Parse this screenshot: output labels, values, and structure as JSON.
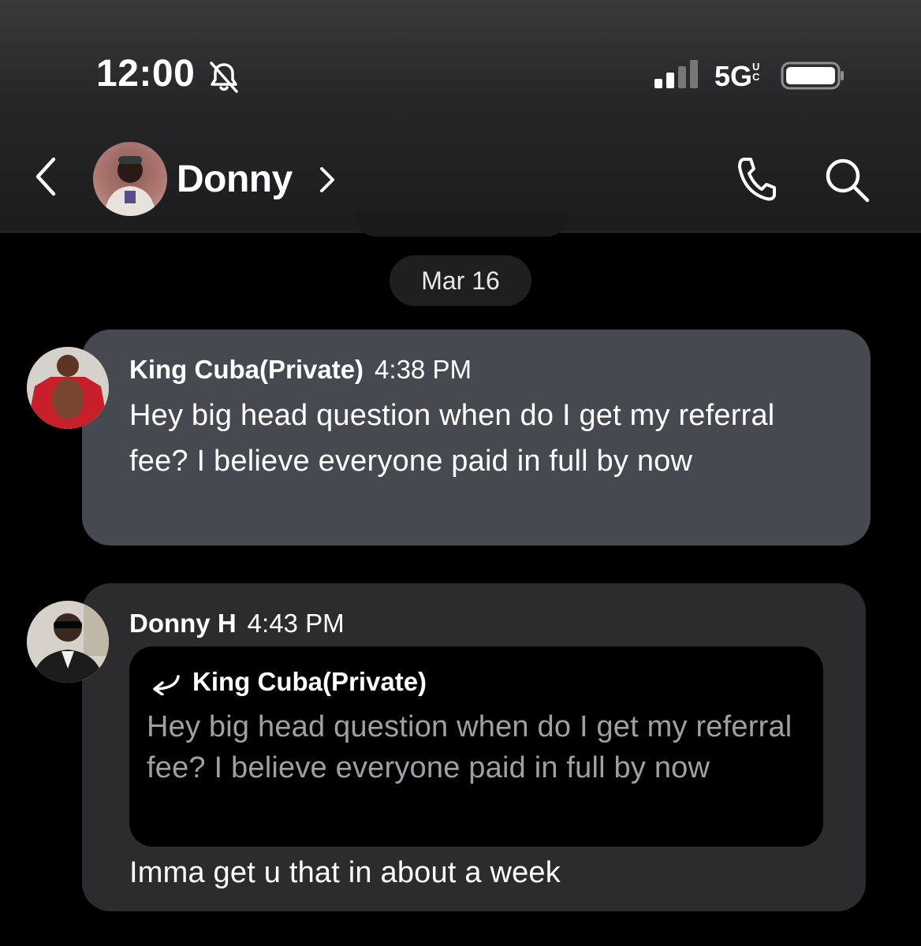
{
  "status_bar": {
    "time": "12:00",
    "network": "5G",
    "network_suffix": "UC",
    "icons": [
      "bell-muted-icon",
      "signal-icon",
      "battery-icon"
    ]
  },
  "header": {
    "contact_name": "Donny",
    "icons": [
      "back-arrow-icon",
      "chevron-right-icon",
      "phone-icon",
      "search-icon"
    ]
  },
  "conversation": {
    "date_divider": "Mar 16",
    "messages": [
      {
        "sender": "King Cuba(Private)",
        "time": "4:38 PM",
        "text": "Hey big head question when do I get my referral fee? I believe everyone paid in full by now"
      },
      {
        "sender": "Donny H",
        "time": "4:43 PM",
        "reply_to": {
          "sender": "King Cuba(Private)",
          "text": "Hey big head question when do I get my referral fee? I believe everyone paid in full by now"
        },
        "text": "Imma get u that in about a week"
      }
    ]
  },
  "colors": {
    "background": "#000000",
    "incoming_bubble": "#464950",
    "outgoing_bubble": "#2c2c2e",
    "quote_bg": "#000000",
    "quote_text": "#a0a0a4"
  }
}
